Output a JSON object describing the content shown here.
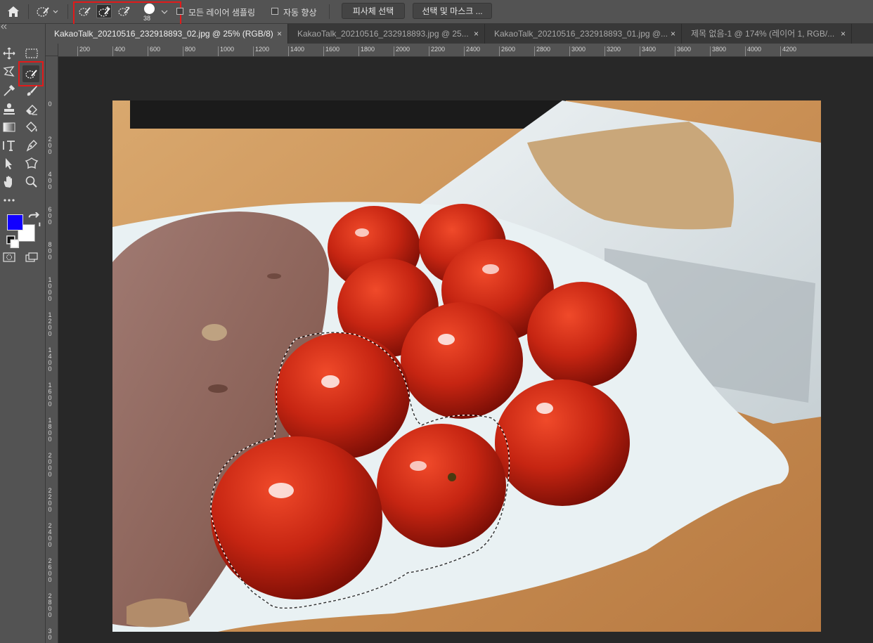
{
  "options_bar": {
    "brush_size": "38",
    "sample_all_layers_label": "모든 레이어 샘플링",
    "auto_enhance_label": "자동 향상",
    "select_subject_label": "피사체 선택",
    "select_and_mask_label": "선택 및 마스크 ..."
  },
  "tabs": [
    {
      "label": "KakaoTalk_20210516_232918893_02.jpg @ 25% (RGB/8)",
      "close": "×"
    },
    {
      "label": "KakaoTalk_20210516_232918893.jpg @ 25...",
      "close": "×"
    },
    {
      "label": "KakaoTalk_20210516_232918893_01.jpg @...",
      "close": "×"
    },
    {
      "label": "제목 없음-1 @ 174% (레이어 1, RGB/...",
      "close": "×"
    }
  ],
  "ruler_h": [
    "200",
    "400",
    "600",
    "800",
    "1000",
    "1200",
    "1400",
    "1600",
    "1800",
    "2000",
    "2200",
    "2400",
    "2600",
    "2800",
    "3000",
    "3200",
    "3400",
    "3600",
    "3800",
    "4000",
    "4200"
  ],
  "ruler_v": [
    "0",
    "2 0 0",
    "4 0 0",
    "6 0 0",
    "8 0 0",
    "1 0 0 0",
    "1 2 0 0",
    "1 4 0 0",
    "1 6 0 0",
    "1 8 0 0",
    "2 0 0 0",
    "2 2 0 0",
    "2 4 0 0",
    "2 6 0 0",
    "2 8 0 0",
    "3 0"
  ],
  "tools": [
    "move-tool",
    "rect-marquee-tool",
    "lasso-tool",
    "object-select-tool",
    "eyedropper-tool",
    "brush-tool",
    "stamp-tool",
    "eraser-tool",
    "gradient-tool",
    "paint-bucket-tool",
    "type-tool",
    "pen-tool",
    "path-select-tool",
    "shape-tool",
    "hand-tool",
    "zoom-tool",
    "more-tools"
  ],
  "colors": {
    "foreground": "#1100ff",
    "background": "#ffffff",
    "highlight": "#e21a1a"
  }
}
